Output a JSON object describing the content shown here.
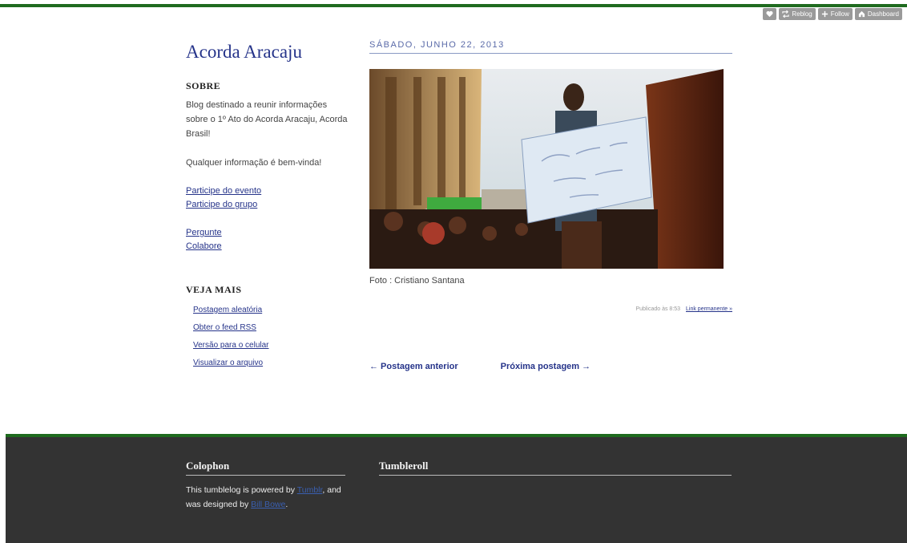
{
  "topbar": {
    "like_icon": "heart-icon",
    "reblog_label": "Reblog",
    "follow_label": "Follow",
    "dashboard_label": "Dashboard"
  },
  "sidebar": {
    "site_title": "Acorda Aracaju",
    "about_heading": "SOBRE",
    "about_text": "Blog destinado a reunir informações sobre o 1º Ato do Acorda Aracaju, Acorda Brasil!",
    "info_text": "Qualquer informação é bem-vinda!",
    "links_group1": [
      "Participe do evento",
      "Participe do grupo"
    ],
    "links_group2": [
      "Pergunte",
      "Colabore"
    ],
    "more_heading": "VEJA MAIS",
    "more_links": [
      "Postagem aleatória",
      "Obter o feed RSS",
      "Versão para o celular",
      "Visualizar o arquivo"
    ]
  },
  "post": {
    "date": "SÁBADO, JUNHO 22, 2013",
    "caption": "Foto : Cristiano Santana",
    "posted_at": "Publicado às 8:53",
    "permalink": "Link permanente »",
    "prev_label": "← Postagem anterior",
    "next_label": "Próxima postagem →"
  },
  "footer": {
    "colophon_heading": "Colophon",
    "colophon_text_1": "This tumblelog is powered by ",
    "colophon_link_1": "Tumblr",
    "colophon_text_2": ", and was designed by ",
    "colophon_link_2": "Bill Bowe",
    "colophon_text_3": ".",
    "tumbleroll_heading": "Tumbleroll"
  },
  "colors": {
    "accent_green": "#1f6b1f",
    "link_blue": "#26348a",
    "footer_bg": "#333333"
  }
}
